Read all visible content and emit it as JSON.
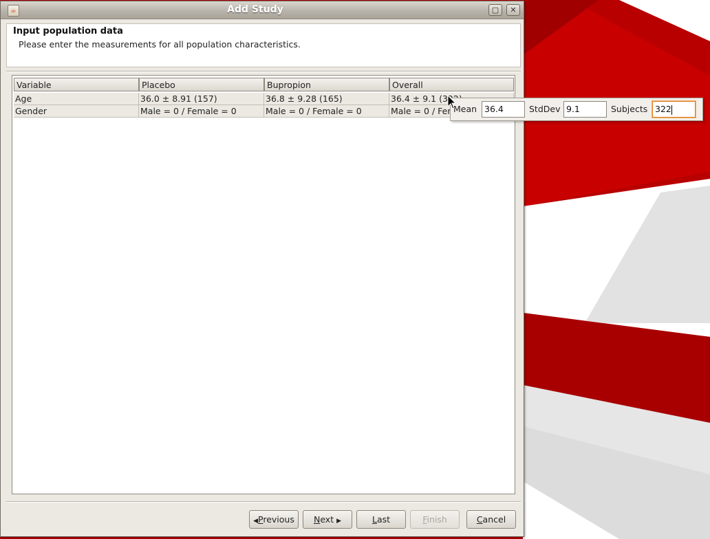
{
  "window": {
    "title": "Add Study",
    "icon": "java-app-icon",
    "maximize_glyph": "▢",
    "close_glyph": "✕"
  },
  "header": {
    "title": "Input population data",
    "subtitle": "Please enter the measurements for all population characteristics."
  },
  "table": {
    "columns": [
      "Variable",
      "Placebo",
      "Bupropion",
      "Overall"
    ],
    "rows": [
      {
        "cells": [
          "Age",
          "36.0 ± 8.91 (157)",
          "36.8 ± 9.28 (165)",
          "36.4 ± 9.1 (322)"
        ]
      },
      {
        "cells": [
          "Gender",
          "Male = 0 / Female = 0",
          "Male = 0 / Female = 0",
          "Male = 0 / Female = 0"
        ]
      }
    ]
  },
  "editor_popup": {
    "mean_label": "Mean",
    "mean_value": "36.4",
    "stddev_label": "StdDev",
    "stddev_value": "9.1",
    "subjects_label": "Subjects",
    "subjects_value": "322"
  },
  "buttons": {
    "previous": {
      "arrow": "◀",
      "mnemonic": "P",
      "rest": "revious"
    },
    "next": {
      "mnemonic": "N",
      "rest": "ext",
      "arrow": "▶"
    },
    "last": {
      "mnemonic": "L",
      "rest": "ast"
    },
    "finish": {
      "mnemonic": "F",
      "rest": "inish"
    },
    "cancel": {
      "mnemonic": "C",
      "rest": "ancel"
    }
  },
  "colors": {
    "desktop_red": "#b00000",
    "desktop_dark_red": "#8e0000",
    "desktop_light": "#e4e4e4",
    "focus_orange": "#e07a1f"
  }
}
